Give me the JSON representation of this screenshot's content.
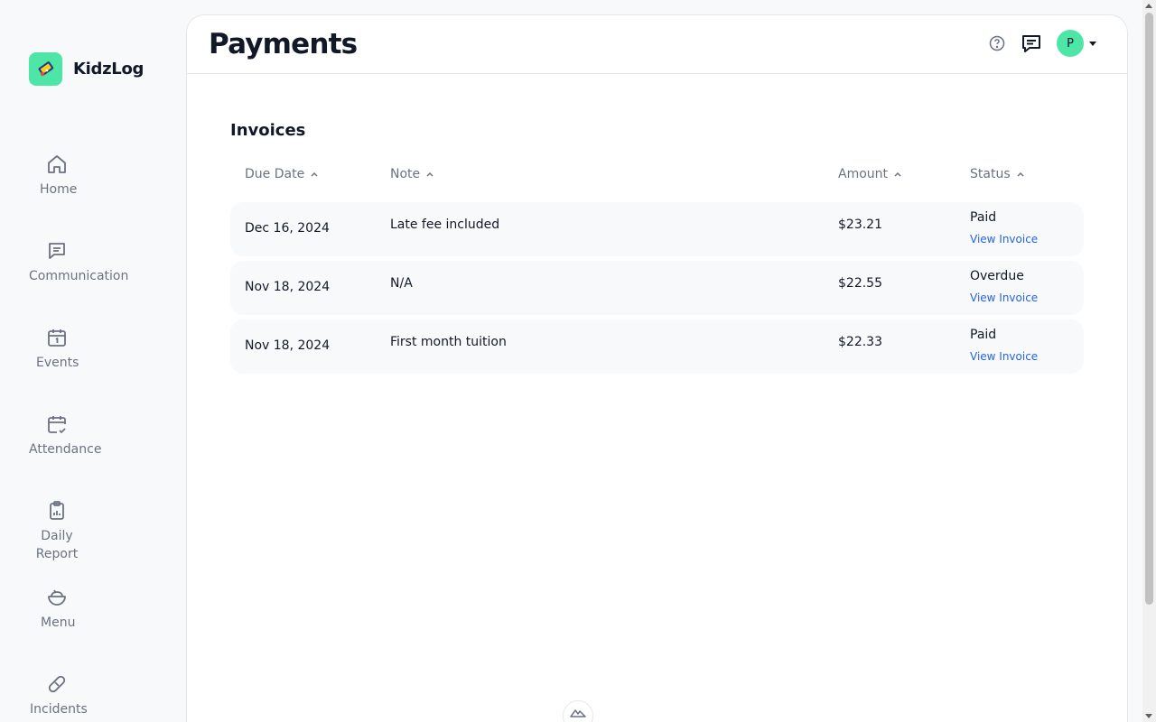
{
  "app": {
    "name": "KidzLog"
  },
  "sidebar": {
    "items": [
      {
        "label": "Home",
        "icon": "home-icon"
      },
      {
        "label": "Communication",
        "icon": "message-icon"
      },
      {
        "label": "Events",
        "icon": "calendar-icon"
      },
      {
        "label": "Attendance",
        "icon": "calendar-check-icon"
      },
      {
        "label": "Daily Report",
        "icon": "clipboard-report-icon"
      },
      {
        "label": "Menu",
        "icon": "bowl-icon"
      },
      {
        "label": "Incidents",
        "icon": "bandage-icon"
      }
    ]
  },
  "header": {
    "title": "Payments",
    "avatar_initial": "P"
  },
  "invoices": {
    "title": "Invoices",
    "columns": [
      "Due Date",
      "Note",
      "Amount",
      "Status"
    ],
    "rows": [
      {
        "due_date": "Dec 16, 2024",
        "note": "Late fee included",
        "amount": "$23.21",
        "status": "Paid",
        "link": "View Invoice"
      },
      {
        "due_date": "Nov 18, 2024",
        "note": "N/A",
        "amount": "$22.55",
        "status": "Overdue",
        "link": "View Invoice"
      },
      {
        "due_date": "Nov 18, 2024",
        "note": "First month tuition",
        "amount": "$22.33",
        "status": "Paid",
        "link": "View Invoice"
      }
    ]
  },
  "colors": {
    "brand": "#4ee6a6",
    "link": "#2563eb",
    "muted": "#6b7280"
  }
}
